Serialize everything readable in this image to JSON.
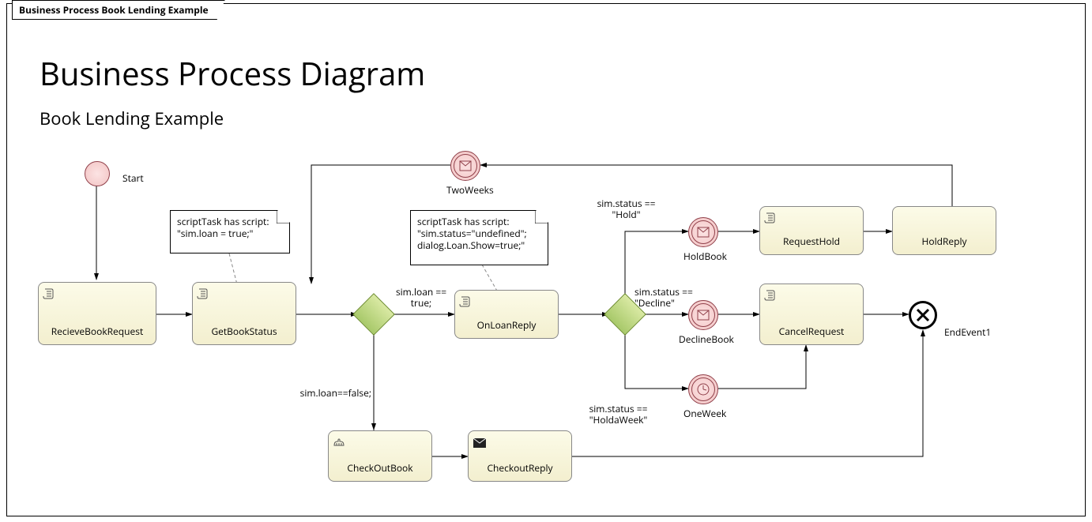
{
  "frame_tab": "Business Process Book Lending Example",
  "title": "Business Process Diagram",
  "subtitle": "Book Lending Example",
  "start_label": "Start",
  "tasks": {
    "recieve": "RecieveBookRequest",
    "getstatus": "GetBookStatus",
    "onloanreply": "OnLoanReply",
    "checkoutbook": "CheckOutBook",
    "checkoutreply": "CheckoutReply",
    "requesthold": "RequestHold",
    "holdreply": "HoldReply",
    "cancelrequest": "CancelRequest"
  },
  "events": {
    "twoweeks": "TwoWeeks",
    "holdbook": "HoldBook",
    "declinebook": "DeclineBook",
    "oneweek": "OneWeek",
    "endevent1": "EndEvent1"
  },
  "notes": {
    "note1_line1": "scriptTask has script:",
    "note1_line2": "\"sim.loan = true;\"",
    "note2_line1": "scriptTask has script:",
    "note2_line2": "\"sim.status=\"undefined\";",
    "note2_line3": "dialog.Loan.Show=true;\""
  },
  "conditions": {
    "loan_true_l1": "sim.loan ==",
    "loan_true_l2": "true;",
    "loan_false": "sim.loan==false;",
    "status_hold_l1": "sim.status ==",
    "status_hold_l2": "\"Hold\"",
    "status_decline_l1": "sim.status ==",
    "status_decline_l2": "\"Decline\"",
    "status_holdweek_l1": "sim.status ==",
    "status_holdweek_l2": "\"HoldaWeek\""
  }
}
